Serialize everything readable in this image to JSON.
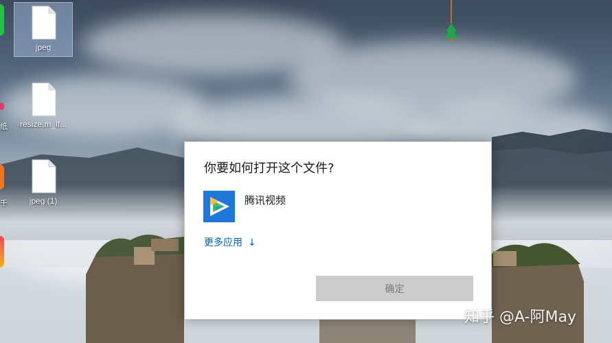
{
  "desktop": {
    "icons": [
      {
        "label": "jpeg",
        "selected": true,
        "icon": "file-icon"
      },
      {
        "label": "resize,m_lf...",
        "selected": false,
        "icon": "file-icon"
      },
      {
        "label": "jpeg (1)",
        "selected": false,
        "icon": "file-icon"
      }
    ],
    "edge_labels": [
      "纸",
      "千"
    ]
  },
  "dialog": {
    "title": "你要如何打开这个文件?",
    "app": {
      "name": "腾讯视频",
      "icon": "tencent-video-icon",
      "icon_color": "#1f78d7"
    },
    "more_apps_label": "更多应用",
    "more_apps_arrow": "↓",
    "ok_label": "确定",
    "ok_enabled": false
  },
  "watermark": "知乎 @A-阿May",
  "colors": {
    "link": "#0063b1",
    "button_disabled_bg": "#cccccc",
    "button_disabled_text": "#7a7a7a",
    "selection": "#adc8eb"
  }
}
